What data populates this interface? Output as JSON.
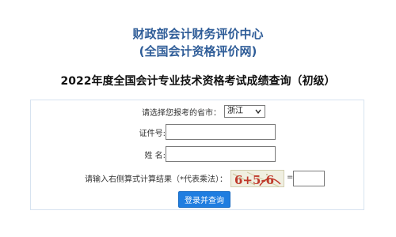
{
  "header": {
    "org_line1": "财政部会计财务评价中心",
    "org_line2": "(全国会计资格评价网)",
    "page_title": "2022年度全国会计专业技术资格考试成绩查询（初级）"
  },
  "form": {
    "province_label": "请选择您报考的省市：",
    "province_selected": "浙江",
    "id_label": "证件号:",
    "id_value": "",
    "name_label": "姓  名:",
    "name_value": "",
    "captcha_label": "请输入右侧算式计算结果（*代表乘法）：",
    "captcha_text": "6+5-6",
    "equals": "=",
    "captcha_answer": "",
    "submit_label": "登录并查询"
  },
  "colors": {
    "org_title": "#2f5d98",
    "button": "#1f7de0",
    "panel_border": "#d7e3f0"
  }
}
